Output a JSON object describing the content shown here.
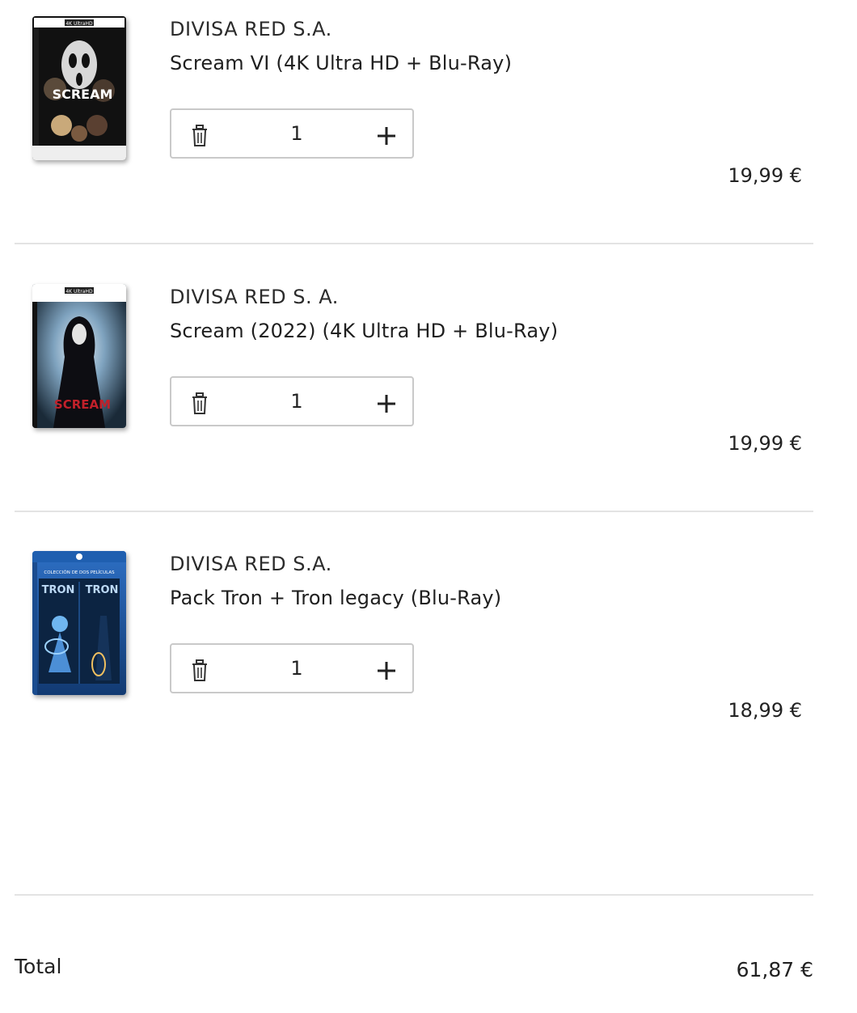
{
  "cart": {
    "items": [
      {
        "seller": "DIVISA RED S.A.",
        "title": "Scream VI (4K Ultra HD + Blu-Ray)",
        "quantity": "1",
        "price": "19,99 €",
        "cover_icon": "scream-vi-cover",
        "cover_text": "SCREAM",
        "cover_badge": "4K UltraHD"
      },
      {
        "seller": "DIVISA RED S. A.",
        "title": "Scream (2022) (4K Ultra HD + Blu-Ray)",
        "quantity": "1",
        "price": "19,99 €",
        "cover_icon": "scream-2022-cover",
        "cover_text": "SCREAM",
        "cover_badge": "4K UltraHD"
      },
      {
        "seller": "DIVISA RED S.A.",
        "title": "Pack Tron + Tron legacy (Blu-Ray)",
        "quantity": "1",
        "price": "18,99 €",
        "cover_icon": "tron-pack-cover",
        "cover_text": "TRON",
        "cover_badge": "COLECCIÓN DE DOS PELÍCULAS"
      }
    ],
    "delete_icon": "trash-icon",
    "increment_icon": "plus-icon"
  },
  "summary": {
    "total_label": "Total",
    "total_value": "61,87 €"
  },
  "colors": {
    "text": "#222222",
    "border": "#c9c9c9",
    "divider": "#e3e3e3",
    "tron_blue": "#1f5fb0"
  }
}
